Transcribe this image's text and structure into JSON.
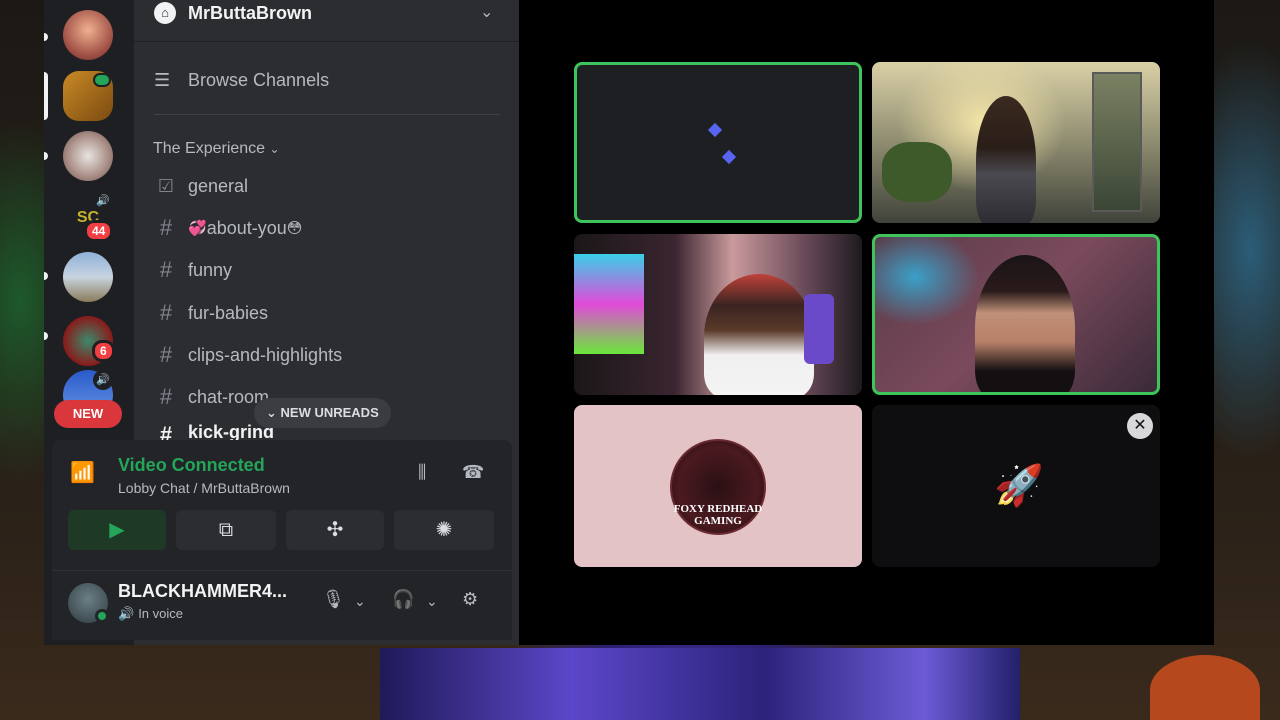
{
  "server": {
    "name": "MrButtaBrown",
    "browse_label": "Browse Channels",
    "category": "The Experience",
    "channels": [
      {
        "name": "general",
        "icon": "rules-icon"
      },
      {
        "name": "about-you",
        "prefix_emoji": "💞",
        "suffix_emoji": "😳",
        "icon": "hash"
      },
      {
        "name": "funny",
        "icon": "hash"
      },
      {
        "name": "fur-babies",
        "icon": "hash"
      },
      {
        "name": "clips-and-highlights",
        "icon": "hash"
      },
      {
        "name": "chat-room",
        "icon": "hash"
      },
      {
        "name": "kick-grind",
        "icon": "hash",
        "unread": true
      }
    ],
    "new_unreads_label": "NEW UNREADS"
  },
  "server_rail": {
    "badges": [
      "44",
      "6"
    ],
    "new_label": "NEW"
  },
  "voice": {
    "status": "Video Connected",
    "location": "Lobby Chat / MrButtaBrown"
  },
  "user": {
    "name": "BLACKHAMMER4...",
    "status": "In voice"
  },
  "stage": {
    "logo_text": "FOXY REDHEAD GAMING"
  },
  "colors": {
    "accent_green": "#23a55a",
    "speaking_border": "#3ec45c",
    "badge_red": "#f23f43",
    "blurple": "#5865f2"
  }
}
